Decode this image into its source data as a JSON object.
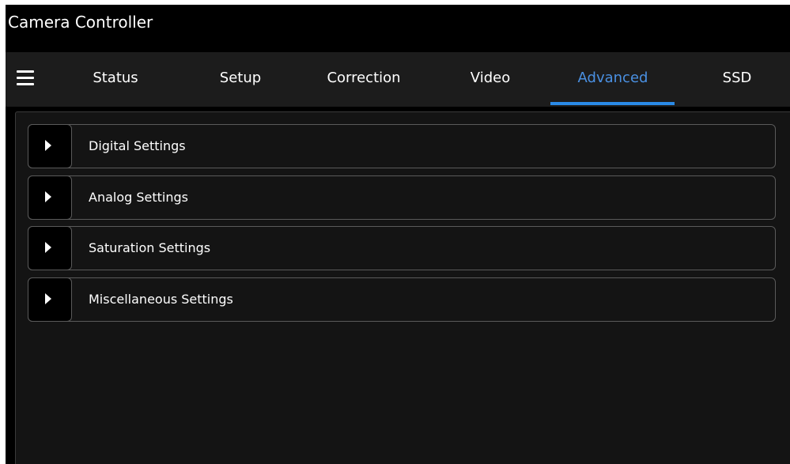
{
  "window": {
    "title": "Camera Controller"
  },
  "menu_icon": "hamburger-menu-icon",
  "tabs": [
    {
      "label": "Status",
      "active": false
    },
    {
      "label": "Setup",
      "active": false
    },
    {
      "label": "Correction",
      "active": false
    },
    {
      "label": "Video",
      "active": false
    },
    {
      "label": "Advanced",
      "active": true
    },
    {
      "label": "SSD",
      "active": false
    }
  ],
  "sections": [
    {
      "label": "Digital Settings",
      "icon": "triangle-right-icon",
      "expanded": false
    },
    {
      "label": "Analog Settings",
      "icon": "triangle-right-icon",
      "expanded": false
    },
    {
      "label": "Saturation Settings",
      "icon": "triangle-right-icon",
      "expanded": false
    },
    {
      "label": "Miscellaneous Settings",
      "icon": "triangle-right-icon",
      "expanded": false
    }
  ],
  "colors": {
    "accent": "#2a8ae6",
    "active_tab_text": "#4a90e2",
    "background": "#000000",
    "tabbar": "#1c1c1c",
    "panel": "#141414"
  }
}
